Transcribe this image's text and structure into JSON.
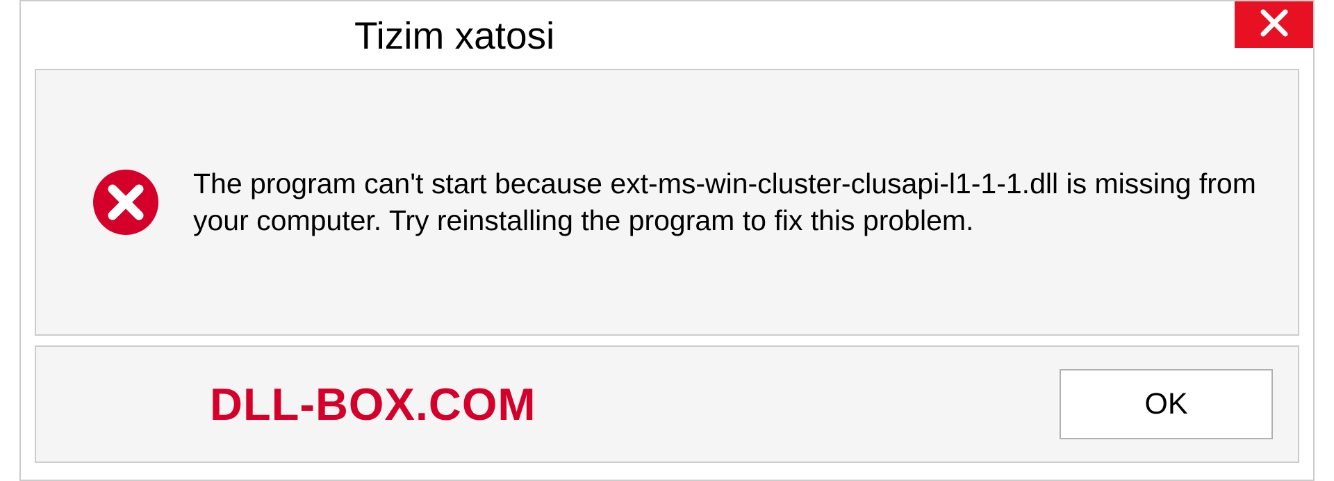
{
  "dialog": {
    "title": "Tizim xatosi",
    "message": "The program can't start because ext-ms-win-cluster-clusapi-l1-1-1.dll is missing from your computer. Try reinstalling the program to fix this problem.",
    "ok_label": "OK",
    "watermark": "DLL-BOX.COM"
  }
}
